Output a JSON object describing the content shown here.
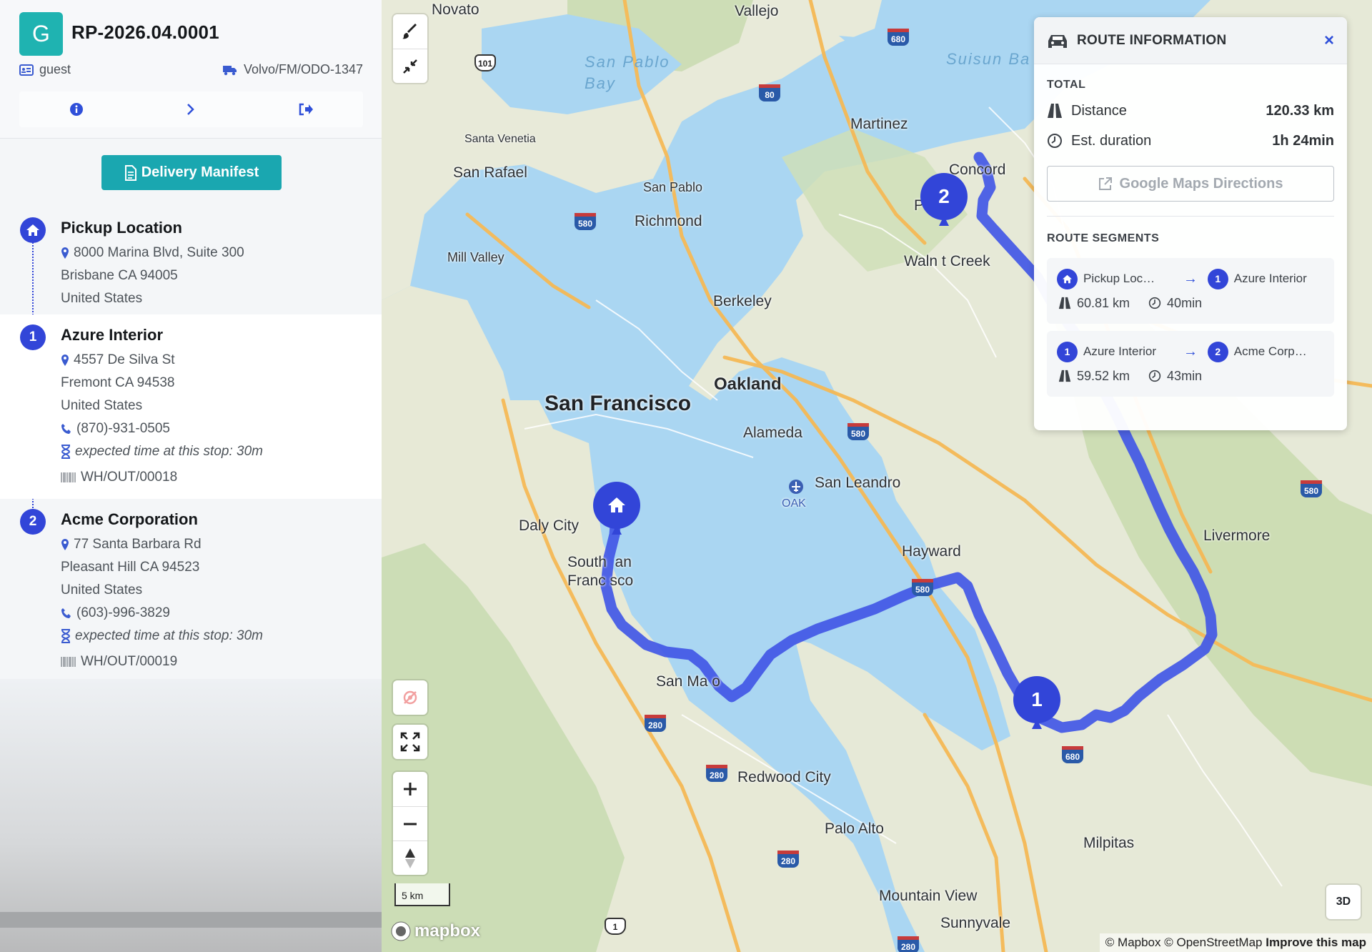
{
  "plan": {
    "reference": "RP-2026.04.0001",
    "avatar_letter": "G",
    "user": "guest",
    "vehicle": "Volvo/FM/ODO-1347"
  },
  "actions": {
    "manifest_label": "Delivery Manifest",
    "icons": [
      "info-icon",
      "chevron-right-icon",
      "sign-out-icon"
    ]
  },
  "stops": [
    {
      "marker": "home",
      "title": "Pickup Location",
      "address": "8000 Marina Blvd, Suite 300",
      "city": "Brisbane CA 94005",
      "country": "United States"
    },
    {
      "marker": "1",
      "title": "Azure Interior",
      "address": "4557 De Silva St",
      "city": "Fremont CA 94538",
      "country": "United States",
      "phone": "(870)-931-0505",
      "expected": "expected time at this stop: 30m",
      "ref": "WH/OUT/00018"
    },
    {
      "marker": "2",
      "title": "Acme Corporation",
      "address": "77 Santa Barbara Rd",
      "city": "Pleasant Hill CA 94523",
      "country": "United States",
      "phone": "(603)-996-3829",
      "expected": "expected time at this stop: 30m",
      "ref": "WH/OUT/00019"
    }
  ],
  "route_info": {
    "title": "ROUTE INFORMATION",
    "close": "×",
    "total_label": "TOTAL",
    "distance_label": "Distance",
    "distance_value": "120.33 km",
    "duration_label": "Est. duration",
    "duration_value": "1h 24min",
    "gmaps_label": "Google Maps Directions",
    "segments_label": "ROUTE SEGMENTS",
    "segments": [
      {
        "from_marker": "home",
        "from": "Pickup Loc…",
        "arrow": "→",
        "to_marker": "1",
        "to": "Azure Interior",
        "distance": "60.81 km",
        "duration": "40min"
      },
      {
        "from_marker": "1",
        "from": "Azure Interior",
        "arrow": "→",
        "to_marker": "2",
        "to": "Acme Corp…",
        "distance": "59.52 km",
        "duration": "43min"
      }
    ]
  },
  "map": {
    "labels": {
      "novato": "Novato",
      "vallejo": "Vallejo",
      "san_pablo_bay": "San Pablo\nBay",
      "suisun": "Suisun Ba",
      "martinez": "Martinez",
      "concord": "Concord",
      "pleasant_hill": "P      t Hill",
      "walnut_creek": "Waln t Creek",
      "san_rafael": "San Rafael",
      "santa_venetia": "Santa Venetia",
      "san_pablo": "San Pablo",
      "richmond": "Richmond",
      "mill_valley": "Mill Valley",
      "berkeley": "Berkeley",
      "oakland": "Oakland",
      "san_francisco": "San Francisco",
      "alameda": "Alameda",
      "san_leandro": "San Leandro",
      "oak": "OAK",
      "daly_city": "Daly City",
      "south_sf": "South  an\nFranc sco",
      "hayward": "Hayward",
      "livermore": "Livermore",
      "san_mateo": "San Ma  o",
      "redwood_city": "Redwood City",
      "palo_alto": "Palo Alto",
      "milpitas": "Milpitas",
      "mountain_view": "Mountain View",
      "sunnyvale": "Sunnyvale"
    },
    "shields": [
      "680",
      "101",
      "80",
      "580",
      "580",
      "580",
      "580",
      "280",
      "280",
      "280",
      "680",
      "280",
      "1"
    ],
    "route_markers": [
      "home",
      "1",
      "2"
    ],
    "scale_label": "5 km",
    "logo_text": "mapbox",
    "btn_3d": "3D",
    "attribution": "© Mapbox © OpenStreetMap",
    "improve": "Improve this map"
  },
  "colors": {
    "accent": "#1aa7b0",
    "route": "#3a4fe0",
    "marker": "#3245d8",
    "water": "#aad6f2"
  }
}
